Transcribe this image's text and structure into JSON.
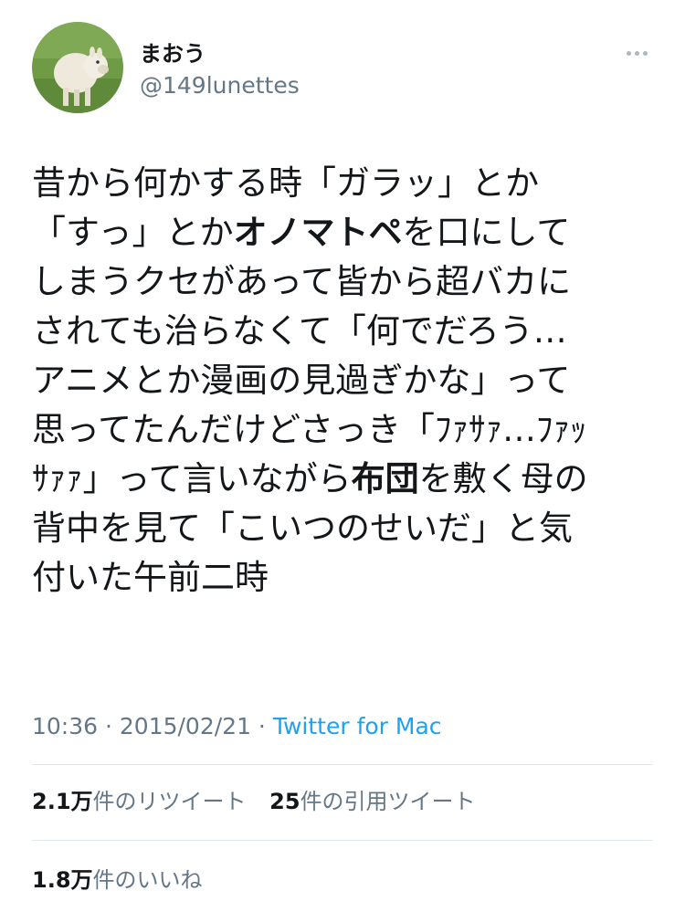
{
  "author": {
    "display_name": "まおう",
    "handle": "@149lunettes",
    "avatar_icon": "alpaca-avatar"
  },
  "tweet": {
    "segments": [
      [
        {
          "t": "昔から何かする時「ガラッ」とか",
          "b": false
        }
      ],
      [
        {
          "t": "「すっ」とか",
          "b": false
        },
        {
          "t": "オノマトペ",
          "b": true
        },
        {
          "t": "を口にして",
          "b": false
        }
      ],
      [
        {
          "t": "しまうクセがあって皆から超バカに",
          "b": false
        }
      ],
      [
        {
          "t": "されても治らなくて「何でだろう…",
          "b": false
        }
      ],
      [
        {
          "t": "アニメとか漫画の見過ぎかな」って",
          "b": false
        }
      ],
      [
        {
          "t": "思ってたんだけどさっき「ﾌｧｻｧ…ﾌｧｯ",
          "b": false
        }
      ],
      [
        {
          "t": "ｻｧｧ」って言いながら",
          "b": false
        },
        {
          "t": "布団",
          "b": true
        },
        {
          "t": "を敷く母の",
          "b": false
        }
      ],
      [
        {
          "t": "背中を見て「こいつのせいだ」と気",
          "b": false
        }
      ],
      [
        {
          "t": "付いた午前二時",
          "b": false
        }
      ]
    ]
  },
  "meta": {
    "time": "10:36",
    "sep1": " · ",
    "date": "2015/02/21",
    "sep2": " · ",
    "client": "Twitter for Mac"
  },
  "stats": {
    "retweets_num": "2.1万",
    "retweets_label": "件のリツイート",
    "quotes_num": "25",
    "quotes_label": "件の引用ツイート",
    "likes_num": "1.8万",
    "likes_label": "件のいいね"
  },
  "colors": {
    "text": "#14171a",
    "secondary": "#657786",
    "link": "#1da1f2",
    "divider": "#e1e8ed"
  }
}
